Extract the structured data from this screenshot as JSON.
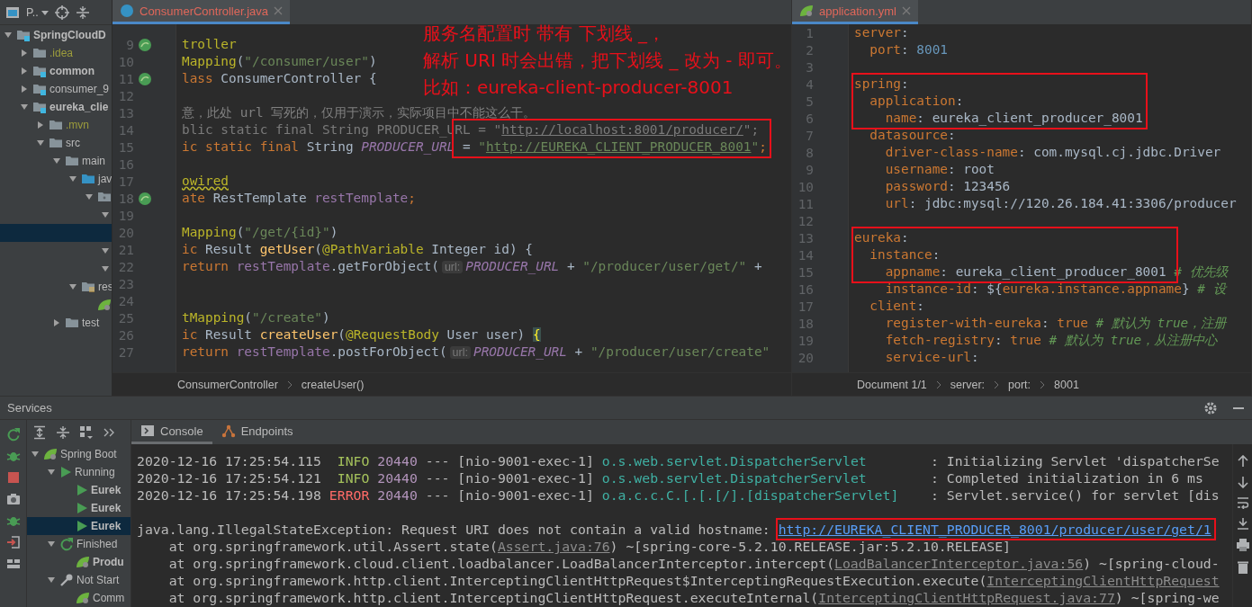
{
  "project": {
    "view_label": "P..",
    "tree": [
      {
        "label": "SpringCloudD",
        "kind": "module",
        "bold": true,
        "selected": false,
        "expanded": true,
        "children": [
          {
            "label": ".idea",
            "kind": "ignored",
            "bold": false,
            "selected": false,
            "expanded": false
          },
          {
            "label": "common",
            "kind": "module",
            "bold": true,
            "selected": false,
            "expanded": false
          },
          {
            "label": "consumer_9",
            "kind": "module",
            "bold": false,
            "selected": false,
            "expanded": false
          },
          {
            "label": "eureka_clie",
            "kind": "module",
            "bold": true,
            "selected": false,
            "expanded": true,
            "children": [
              {
                "label": ".mvn",
                "kind": "ignored",
                "bold": false,
                "selected": false,
                "expanded": false
              },
              {
                "label": "src",
                "kind": "folder",
                "bold": false,
                "selected": false,
                "expanded": true,
                "children": [
                  {
                    "label": "main",
                    "kind": "folder",
                    "bold": false,
                    "selected": false,
                    "expanded": true,
                    "children": [
                      {
                        "label": "jav",
                        "kind": "source",
                        "bold": false,
                        "selected": false,
                        "expanded": true,
                        "children": [
                          {
                            "kind": "package",
                            "selected": false,
                            "expanded": true,
                            "children": [
                              {
                                "selected": false,
                                "expanded": true,
                                "children": [
                                  {
                                    "selected": true
                                  }
                                ]
                              },
                              {
                                "selected": false,
                                "expanded": true
                              },
                              {
                                "selected": false,
                                "expanded": true
                              }
                            ]
                          }
                        ]
                      },
                      {
                        "label": "res",
                        "kind": "resources",
                        "bold": false,
                        "selected": false,
                        "expanded": true,
                        "children": [
                          {
                            "kind": "spring-config",
                            "selected": false
                          }
                        ]
                      }
                    ]
                  },
                  {
                    "label": "test",
                    "kind": "folder",
                    "bold": false,
                    "selected": false,
                    "expanded": false
                  }
                ]
              }
            ]
          }
        ]
      }
    ]
  },
  "editor": {
    "tab": {
      "label": "ConsumerController.java",
      "kind": "java",
      "selected": true
    },
    "lines": [
      {
        "num": "9",
        "bean_marker": true,
        "tokens": [
          {
            "kind": "ann",
            "text": "troller"
          }
        ]
      },
      {
        "num": "10",
        "tokens": [
          {
            "kind": "ann",
            "text": "Mapping"
          },
          {
            "kind": "plain",
            "text": "("
          },
          {
            "kind": "str",
            "text": "\"/consumer/user\""
          },
          {
            "kind": "plain",
            "text": ")"
          }
        ]
      },
      {
        "num": "11",
        "bean_marker": true,
        "tokens": [
          {
            "kind": "kw",
            "text": "lass "
          },
          {
            "kind": "plain",
            "text": "ConsumerController {"
          }
        ]
      },
      {
        "num": "12"
      },
      {
        "num": "13",
        "tokens": [
          {
            "kind": "comment",
            "text": "意，此处 url 写死的，仅用于演示，实际项目中不能这么干。"
          }
        ]
      },
      {
        "num": "14",
        "unused": true,
        "tokens": [
          {
            "kind": "kw",
            "text": "blic static final "
          },
          {
            "kind": "plain",
            "text": "String PRODUCER_URL "
          },
          {
            "kind": "plain",
            "text": "= ",
            "boxed": true
          },
          {
            "kind": "str",
            "text": "\""
          },
          {
            "kind": "url",
            "text": "http://localhost:8001/producer/"
          },
          {
            "kind": "str",
            "text": "\""
          },
          {
            "kind": "kw",
            "text": ";"
          }
        ]
      },
      {
        "num": "15",
        "unused": false,
        "tokens": [
          {
            "kind": "kw",
            "text": "ic static final "
          },
          {
            "kind": "plain",
            "text": "String "
          },
          {
            "kind": "const",
            "text": "PRODUCER_URL"
          },
          {
            "kind": "plain",
            "text": " = ",
            "boxed": true
          },
          {
            "kind": "str",
            "text": "\""
          },
          {
            "kind": "url",
            "text": "http://EUREKA_CLIENT_PRODUCER_8001"
          },
          {
            "kind": "str",
            "text": "\""
          },
          {
            "kind": "kw",
            "text": ";"
          }
        ]
      },
      {
        "num": "16"
      },
      {
        "num": "17",
        "tokens": [
          {
            "kind": "ann",
            "text": "owired",
            "warning": true
          }
        ]
      },
      {
        "num": "18",
        "bean_marker": true,
        "tokens": [
          {
            "kind": "kw",
            "text": "ate "
          },
          {
            "kind": "plain",
            "text": "RestTemplate "
          },
          {
            "kind": "field",
            "text": "restTemplate"
          },
          {
            "kind": "kw",
            "text": ";"
          }
        ]
      },
      {
        "num": "19"
      },
      {
        "num": "20",
        "tokens": [
          {
            "kind": "ann",
            "text": "Mapping"
          },
          {
            "kind": "plain",
            "text": "("
          },
          {
            "kind": "str",
            "text": "\"/get/{id}\""
          },
          {
            "kind": "plain",
            "text": ")"
          }
        ]
      },
      {
        "num": "21",
        "tokens": [
          {
            "kind": "kw",
            "text": "ic "
          },
          {
            "kind": "plain",
            "text": "Result "
          },
          {
            "kind": "method",
            "text": "getUser"
          },
          {
            "kind": "plain",
            "text": "("
          },
          {
            "kind": "ann",
            "text": "@PathVariable"
          },
          {
            "kind": "plain",
            "text": " Integer id) {"
          }
        ]
      },
      {
        "num": "22",
        "tokens": [
          {
            "kind": "kw",
            "text": "return "
          },
          {
            "kind": "field",
            "text": "restTemplate"
          },
          {
            "kind": "plain",
            "text": ".getForObject("
          },
          {
            "kind": "hint",
            "text": "url:"
          },
          {
            "kind": "const",
            "text": "PRODUCER_URL"
          },
          {
            "kind": "plain",
            "text": " + "
          },
          {
            "kind": "str",
            "text": "\"/producer/user/get/\""
          },
          {
            "kind": "plain",
            "text": " +"
          }
        ]
      },
      {
        "num": "23"
      },
      {
        "num": "24"
      },
      {
        "num": "25",
        "tokens": [
          {
            "kind": "ann",
            "text": "tMapping"
          },
          {
            "kind": "plain",
            "text": "("
          },
          {
            "kind": "str",
            "text": "\"/create\""
          },
          {
            "kind": "plain",
            "text": ")"
          }
        ]
      },
      {
        "num": "26",
        "tokens": [
          {
            "kind": "kw",
            "text": "ic "
          },
          {
            "kind": "plain",
            "text": "Result "
          },
          {
            "kind": "method",
            "text": "createUser"
          },
          {
            "kind": "plain",
            "text": "("
          },
          {
            "kind": "ann",
            "text": "@RequestBody"
          },
          {
            "kind": "plain",
            "text": " User user) "
          },
          {
            "kind": "brace",
            "text": "{"
          }
        ]
      },
      {
        "num": "27",
        "tokens": [
          {
            "kind": "kw",
            "text": "return "
          },
          {
            "kind": "field",
            "text": "restTemplate"
          },
          {
            "kind": "plain",
            "text": ".postForObject("
          },
          {
            "kind": "hint",
            "text": "url:"
          },
          {
            "kind": "const",
            "text": "PRODUCER_URL"
          },
          {
            "kind": "plain",
            "text": " + "
          },
          {
            "kind": "str",
            "text": "\"/producer/user/create\""
          }
        ]
      }
    ],
    "breadcrumbs": [
      "ConsumerController",
      "createUser()"
    ]
  },
  "yaml_editor": {
    "tab": {
      "label": "application.yml",
      "kind": "yaml",
      "selected": true
    },
    "lines": [
      {
        "num": "1",
        "tokens": [
          {
            "kind": "key",
            "text": "server"
          },
          {
            "kind": "plain",
            "text": ":"
          }
        ]
      },
      {
        "num": "2",
        "tokens": [
          {
            "kind": "key",
            "text": "  port"
          },
          {
            "kind": "plain",
            "text": ": "
          },
          {
            "kind": "number",
            "text": "8001"
          }
        ]
      },
      {
        "num": "3"
      },
      {
        "num": "4",
        "tokens": [
          {
            "kind": "key",
            "text": "spring",
            "boxed": true
          },
          {
            "kind": "plain",
            "text": ":"
          }
        ]
      },
      {
        "num": "5",
        "tokens": [
          {
            "kind": "key",
            "text": "  application",
            "boxed": true
          },
          {
            "kind": "plain",
            "text": ":"
          }
        ]
      },
      {
        "num": "6",
        "tokens": [
          {
            "kind": "key",
            "text": "    name",
            "boxed": true
          },
          {
            "kind": "plain",
            "text": ": eureka_client_producer_8001"
          }
        ]
      },
      {
        "num": "7",
        "tokens": [
          {
            "kind": "key",
            "text": "  datasource"
          },
          {
            "kind": "plain",
            "text": ":"
          }
        ]
      },
      {
        "num": "8",
        "tokens": [
          {
            "kind": "key",
            "text": "    driver-class-name"
          },
          {
            "kind": "plain",
            "text": ": com.mysql.cj.jdbc.Driver"
          }
        ]
      },
      {
        "num": "9",
        "tokens": [
          {
            "kind": "key",
            "text": "    username"
          },
          {
            "kind": "plain",
            "text": ": root"
          }
        ]
      },
      {
        "num": "10",
        "tokens": [
          {
            "kind": "key",
            "text": "    password"
          },
          {
            "kind": "plain",
            "text": ": 123456"
          }
        ]
      },
      {
        "num": "11",
        "tokens": [
          {
            "kind": "key",
            "text": "    url"
          },
          {
            "kind": "plain",
            "text": ": jdbc:mysql://120.26.184.41:3306/producer"
          }
        ]
      },
      {
        "num": "12"
      },
      {
        "num": "13",
        "tokens": [
          {
            "kind": "key",
            "text": "eureka",
            "boxed": true
          },
          {
            "kind": "plain",
            "text": ":"
          }
        ]
      },
      {
        "num": "14",
        "tokens": [
          {
            "kind": "key",
            "text": "  instance",
            "boxed": true
          },
          {
            "kind": "plain",
            "text": ":"
          }
        ]
      },
      {
        "num": "15",
        "tokens": [
          {
            "kind": "key",
            "text": "    appname",
            "boxed": true
          },
          {
            "kind": "plain",
            "text": ": eureka_client_producer_8001 "
          },
          {
            "kind": "comment",
            "text": "# 优先级"
          }
        ]
      },
      {
        "num": "16",
        "tokens": [
          {
            "kind": "key",
            "text": "    instance-id"
          },
          {
            "kind": "plain",
            "text": ": ${"
          },
          {
            "kind": "key",
            "text": "eureka.instance.appname"
          },
          {
            "kind": "plain",
            "text": "} "
          },
          {
            "kind": "comment",
            "text": "# 设"
          }
        ]
      },
      {
        "num": "17",
        "tokens": [
          {
            "kind": "key",
            "text": "  client"
          },
          {
            "kind": "plain",
            "text": ":"
          }
        ]
      },
      {
        "num": "18",
        "tokens": [
          {
            "kind": "key",
            "text": "    register-with-eureka"
          },
          {
            "kind": "plain",
            "text": ": "
          },
          {
            "kind": "key",
            "text": "true "
          },
          {
            "kind": "comment",
            "text": "# 默认为 true，注册"
          }
        ]
      },
      {
        "num": "19",
        "tokens": [
          {
            "kind": "key",
            "text": "    fetch-registry"
          },
          {
            "kind": "plain",
            "text": ": "
          },
          {
            "kind": "key",
            "text": "true "
          },
          {
            "kind": "comment",
            "text": "# 默认为 true，从注册中心"
          }
        ]
      },
      {
        "num": "20",
        "tokens": [
          {
            "kind": "key",
            "text": "    service-url"
          },
          {
            "kind": "plain",
            "text": ":"
          }
        ]
      }
    ],
    "breadcrumbs": [
      "Document 1/1",
      "server:",
      "port:",
      "8001"
    ]
  },
  "note": {
    "lines": [
      "服务名配置时 带有 下划线 _，",
      "解析 URI 时会出错，把下划线 _ 改为 - 即可。",
      "比如：eureka-client-producer-8001"
    ]
  },
  "services": {
    "title": "Services",
    "tree": [
      {
        "label": "Spring Boot",
        "kind": "spring",
        "bold": false,
        "selected": false,
        "expanded": true,
        "children": [
          {
            "label": "Running",
            "kind": "running",
            "bold": false,
            "selected": false,
            "expanded": true,
            "children": [
              {
                "label": "Eurek",
                "kind": "app-running",
                "bold": true,
                "selected": false
              },
              {
                "label": "Eurek",
                "kind": "app-running",
                "bold": true,
                "selected": false
              },
              {
                "label": "Eurek",
                "kind": "app-running",
                "bold": true,
                "selected": true
              }
            ]
          },
          {
            "label": "Finished",
            "kind": "finished",
            "bold": false,
            "selected": false,
            "expanded": true,
            "children": [
              {
                "label": "Produ",
                "kind": "app-spring",
                "bold": true,
                "selected": false
              }
            ]
          },
          {
            "label": "Not Start",
            "kind": "not-started",
            "bold": false,
            "selected": false,
            "expanded": true,
            "children": [
              {
                "label": "Comm",
                "kind": "app-spring",
                "bold": false,
                "selected": false
              }
            ]
          }
        ]
      }
    ],
    "tabs": [
      {
        "label": "Console",
        "kind": "console",
        "selected": true
      },
      {
        "label": "Endpoints",
        "kind": "endpoints",
        "selected": false
      }
    ],
    "console_lines": [
      {
        "tokens": [
          {
            "kind": "plain",
            "text": "2020-12-16 17:25:54.115  "
          },
          {
            "kind": "info",
            "text": "INFO"
          },
          {
            "kind": "pid",
            "text": " 20440"
          },
          {
            "kind": "plain",
            "text": " --- [nio-9001-exec-1] "
          },
          {
            "kind": "logger",
            "text": "o.s.web.servlet.DispatcherServlet       "
          },
          {
            "kind": "plain",
            "text": " : Initializing Servlet 'dispatcherSe"
          }
        ]
      },
      {
        "tokens": [
          {
            "kind": "plain",
            "text": "2020-12-16 17:25:54.121  "
          },
          {
            "kind": "info",
            "text": "INFO"
          },
          {
            "kind": "pid",
            "text": " 20440"
          },
          {
            "kind": "plain",
            "text": " --- [nio-9001-exec-1] "
          },
          {
            "kind": "logger",
            "text": "o.s.web.servlet.DispatcherServlet       "
          },
          {
            "kind": "plain",
            "text": " : Completed initialization in 6 ms"
          }
        ]
      },
      {
        "tokens": [
          {
            "kind": "plain",
            "text": "2020-12-16 17:25:54.198 "
          },
          {
            "kind": "error",
            "text": "ERROR"
          },
          {
            "kind": "pid",
            "text": " 20440"
          },
          {
            "kind": "plain",
            "text": " --- [nio-9001-exec-1] "
          },
          {
            "kind": "logger",
            "text": "o.a.c.c.C.[.[.[/].[dispatcherServlet]   "
          },
          {
            "kind": "plain",
            "text": " : Servlet.service() for servlet [dis"
          }
        ]
      },
      {
        "blank_before": true,
        "tokens": [
          {
            "kind": "plain",
            "text": "java.lang.IllegalStateException: Request URI does not contain a valid hostname: "
          },
          {
            "kind": "link",
            "text": "http://EUREKA_CLIENT_PRODUCER_8001/producer/user/get/1",
            "boxed": true
          }
        ]
      },
      {
        "tokens": [
          {
            "kind": "plain",
            "text": "    at org.springframework.util.Assert.state("
          },
          {
            "kind": "source-link",
            "text": "Assert.java:76"
          },
          {
            "kind": "plain",
            "text": ") ~[spring-core-5.2.10.RELEASE.jar:5.2.10.RELEASE]"
          }
        ]
      },
      {
        "tokens": [
          {
            "kind": "plain",
            "text": "    at org.springframework.cloud.client.loadbalancer.LoadBalancerInterceptor.intercept("
          },
          {
            "kind": "source-link",
            "text": "LoadBalancerInterceptor.java:56"
          },
          {
            "kind": "plain",
            "text": ") ~[spring-cloud-"
          }
        ]
      },
      {
        "tokens": [
          {
            "kind": "plain",
            "text": "    at org.springframework.http.client.InterceptingClientHttpRequest$InterceptingRequestExecution.execute("
          },
          {
            "kind": "source-link",
            "text": "InterceptingClientHttpRequest"
          }
        ]
      },
      {
        "tokens": [
          {
            "kind": "plain",
            "text": "    at org.springframework.http.client.InterceptingClientHttpRequest.executeInternal("
          },
          {
            "kind": "source-link",
            "text": "InterceptingClientHttpRequest.java:77"
          },
          {
            "kind": "plain",
            "text": ") ~[spring-we"
          }
        ]
      }
    ]
  }
}
